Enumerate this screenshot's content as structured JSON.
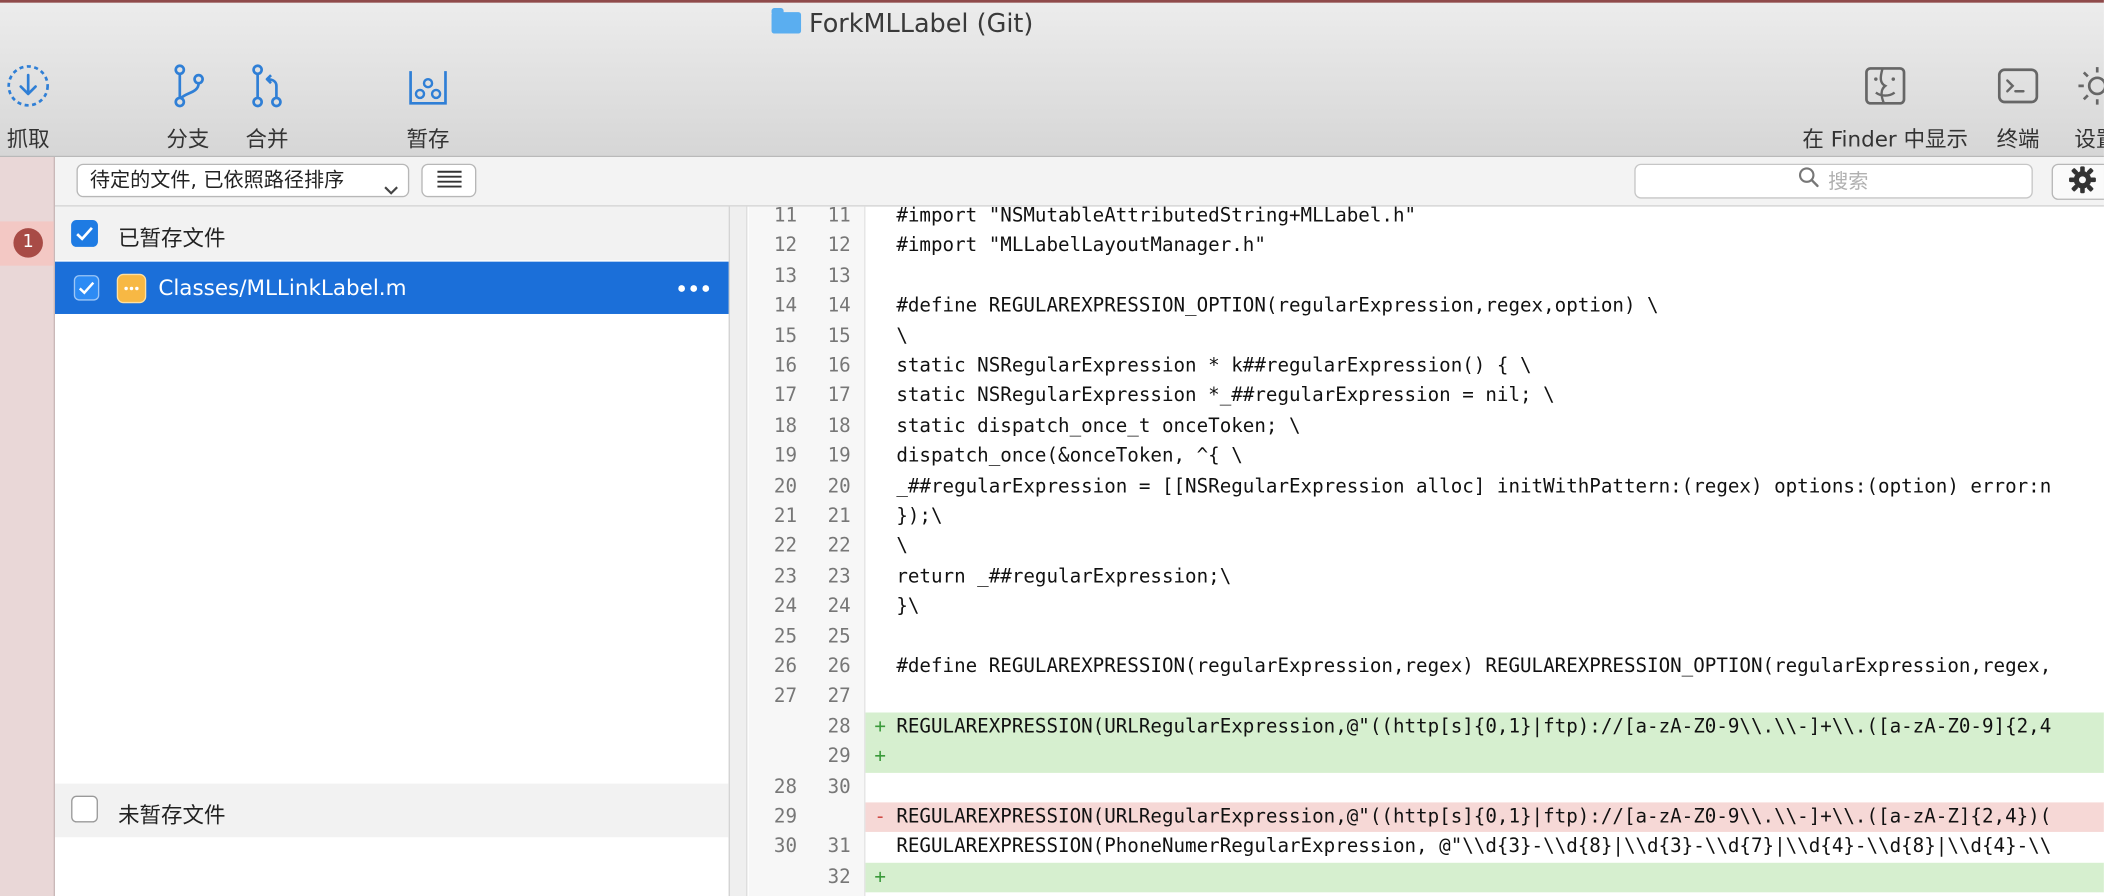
{
  "window": {
    "title": "ForkMLLabel (Git)"
  },
  "toolbar": {
    "fetch_label": "抓取",
    "branch_label": "分支",
    "merge_label": "合并",
    "stash_label": "暂存",
    "finder_label": "在 Finder 中显示",
    "terminal_label": "终端",
    "settings_label": "设置"
  },
  "sidebar": {
    "badge": "1"
  },
  "filter": {
    "sort_value": "待定的文件, 已依照路径排序",
    "search_placeholder": "搜索"
  },
  "files": {
    "staged_header": "已暂存文件",
    "staged_checked": true,
    "unstaged_header": "未暂存文件",
    "unstaged_checked": false,
    "staged_items": [
      {
        "path": "Classes/MLLinkLabel.m",
        "icon": "modified-file-icon",
        "checked": true
      }
    ]
  },
  "diff": {
    "lines": [
      {
        "old": "11",
        "new": "11",
        "kind": "context",
        "text": "#import \"NSMutableAttributedString+MLLabel.h\""
      },
      {
        "old": "12",
        "new": "12",
        "kind": "context",
        "text": "#import \"MLLabelLayoutManager.h\""
      },
      {
        "old": "13",
        "new": "13",
        "kind": "context",
        "text": ""
      },
      {
        "old": "14",
        "new": "14",
        "kind": "context",
        "text": "#define REGULAREXPRESSION_OPTION(regularExpression,regex,option) \\"
      },
      {
        "old": "15",
        "new": "15",
        "kind": "context",
        "text": "\\"
      },
      {
        "old": "16",
        "new": "16",
        "kind": "context",
        "text": "static NSRegularExpression * k##regularExpression() { \\"
      },
      {
        "old": "17",
        "new": "17",
        "kind": "context",
        "text": "static NSRegularExpression *_##regularExpression = nil; \\"
      },
      {
        "old": "18",
        "new": "18",
        "kind": "context",
        "text": "static dispatch_once_t onceToken; \\"
      },
      {
        "old": "19",
        "new": "19",
        "kind": "context",
        "text": "dispatch_once(&onceToken, ^{ \\"
      },
      {
        "old": "20",
        "new": "20",
        "kind": "context",
        "text": "_##regularExpression = [[NSRegularExpression alloc] initWithPattern:(regex) options:(option) error:n"
      },
      {
        "old": "21",
        "new": "21",
        "kind": "context",
        "text": "});\\"
      },
      {
        "old": "22",
        "new": "22",
        "kind": "context",
        "text": "\\"
      },
      {
        "old": "23",
        "new": "23",
        "kind": "context",
        "text": "return _##regularExpression;\\"
      },
      {
        "old": "24",
        "new": "24",
        "kind": "context",
        "text": "}\\"
      },
      {
        "old": "25",
        "new": "25",
        "kind": "context",
        "text": ""
      },
      {
        "old": "26",
        "new": "26",
        "kind": "context",
        "text": "#define REGULAREXPRESSION(regularExpression,regex) REGULAREXPRESSION_OPTION(regularExpression,regex,"
      },
      {
        "old": "27",
        "new": "27",
        "kind": "context",
        "text": ""
      },
      {
        "old": "",
        "new": "28",
        "kind": "add",
        "marker": "+",
        "text": "REGULAREXPRESSION(URLRegularExpression,@\"((http[s]{0,1}|ftp)://[a-zA-Z0-9\\\\.\\\\-]+\\\\.([a-zA-Z0-9]{2,4"
      },
      {
        "old": "",
        "new": "29",
        "kind": "add",
        "marker": "+",
        "text": ""
      },
      {
        "old": "28",
        "new": "30",
        "kind": "context",
        "text": ""
      },
      {
        "old": "29",
        "new": "",
        "kind": "del",
        "marker": "-",
        "text": "REGULAREXPRESSION(URLRegularExpression,@\"((http[s]{0,1}|ftp)://[a-zA-Z0-9\\\\.\\\\-]+\\\\.([a-zA-Z]{2,4})("
      },
      {
        "old": "30",
        "new": "31",
        "kind": "context",
        "text": "REGULAREXPRESSION(PhoneNumerRegularExpression, @\"\\\\d{3}-\\\\d{8}|\\\\d{3}-\\\\d{7}|\\\\d{4}-\\\\d{8}|\\\\d{4}-\\\\"
      },
      {
        "old": "",
        "new": "32",
        "kind": "add",
        "marker": "+",
        "text": ""
      }
    ]
  }
}
